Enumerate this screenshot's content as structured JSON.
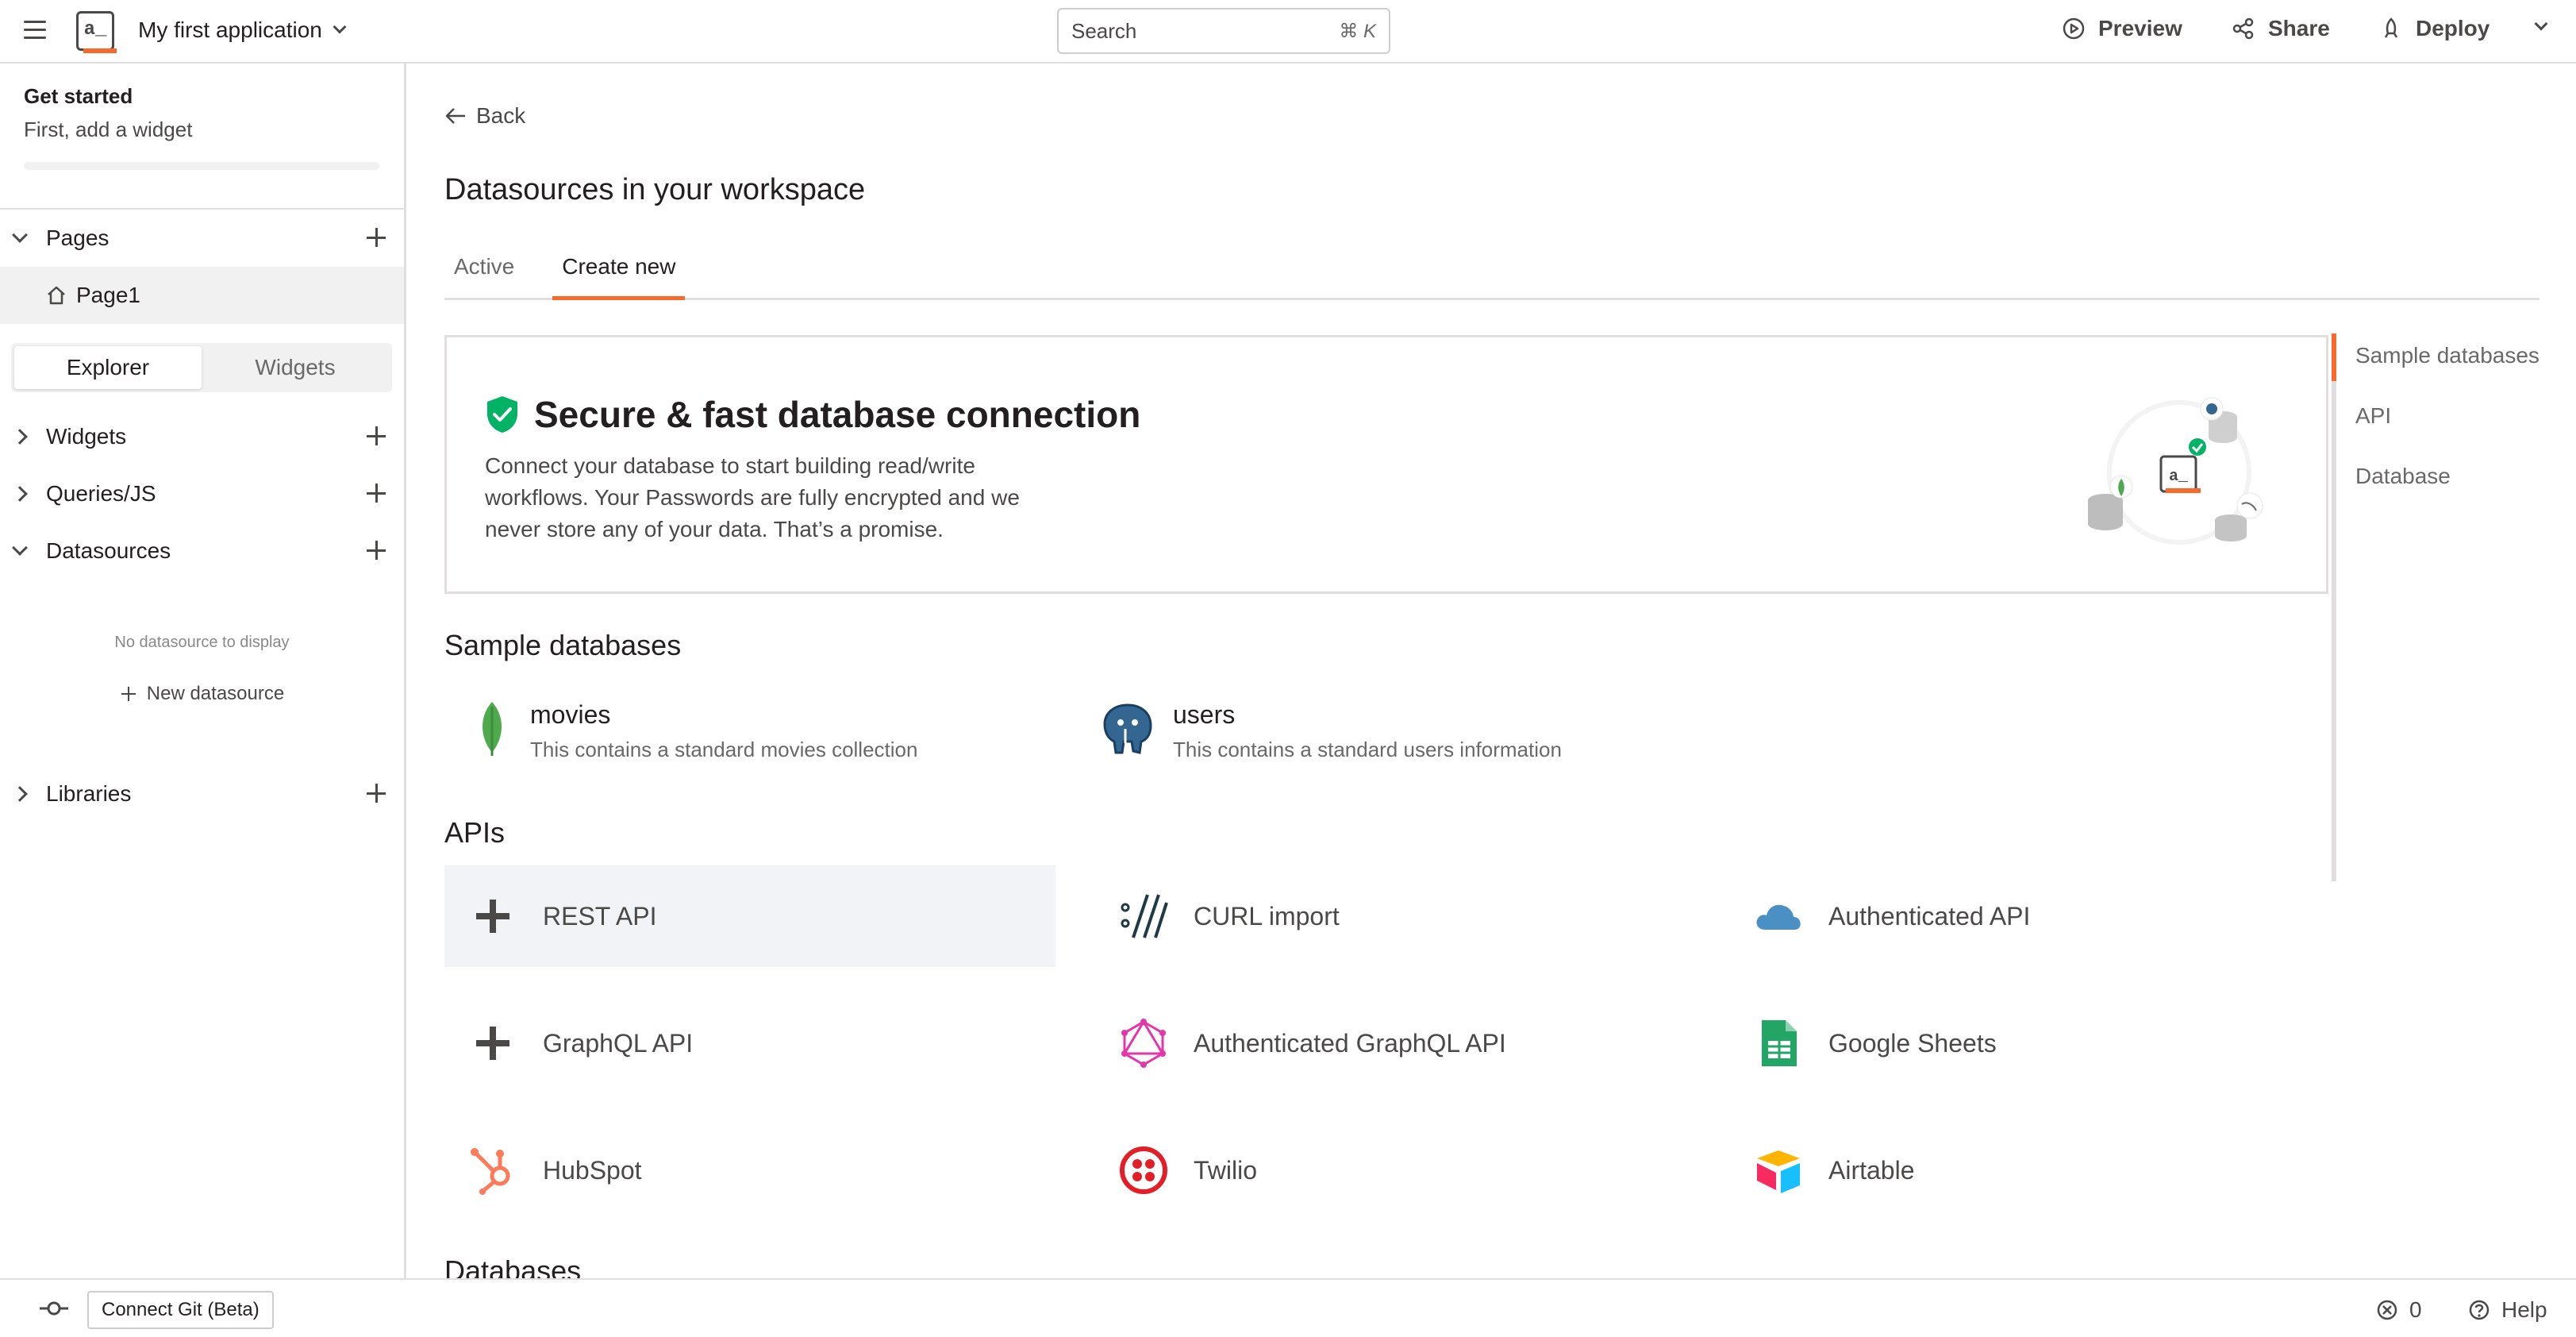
{
  "header": {
    "app_name": "My first application",
    "search_placeholder": "Search",
    "search_shortcut": "⌘ K",
    "preview": "Preview",
    "share": "Share",
    "deploy": "Deploy"
  },
  "sidebar": {
    "get_started_title": "Get started",
    "get_started_sub": "First, add a widget",
    "pages_label": "Pages",
    "page1": "Page1",
    "tab_explorer": "Explorer",
    "tab_widgets": "Widgets",
    "widgets": "Widgets",
    "queries": "Queries/JS",
    "datasources": "Datasources",
    "empty": "No datasource to display",
    "new_datasource": "New datasource",
    "libraries": "Libraries"
  },
  "main": {
    "back": "Back",
    "title": "Datasources in your workspace",
    "tabs": [
      "Active",
      "Create new"
    ],
    "banner": {
      "title": "Secure & fast database connection",
      "desc_lines": [
        "Connect your database to start building read/write",
        "workflows. Your Passwords are fully encrypted and we",
        "never store any of your data. That’s a promise."
      ]
    },
    "sample_heading": "Sample databases",
    "samples": [
      {
        "name": "movies",
        "desc": "This contains a standard movies collection"
      },
      {
        "name": "users",
        "desc": "This contains a standard users information"
      }
    ],
    "apis_heading": "APIs",
    "apis": [
      "REST API",
      "CURL import",
      "Authenticated API",
      "GraphQL API",
      "Authenticated GraphQL API",
      "Google Sheets",
      "HubSpot",
      "Twilio",
      "Airtable"
    ],
    "databases_heading": "Databases"
  },
  "right_nav": [
    "Sample databases",
    "API",
    "Database"
  ],
  "footer": {
    "connect_git": "Connect Git (Beta)",
    "errors": "0",
    "help": "Help"
  },
  "colors": {
    "accent": "#f86a2b",
    "shield": "#03b365",
    "mongo": "#4fa94d",
    "postgres": "#336791",
    "hubspot": "#ff7a59",
    "twilio": "#e31e26",
    "sheets": "#23a566",
    "graphql": "#e535ab",
    "auth_api": "#4a90c4"
  }
}
